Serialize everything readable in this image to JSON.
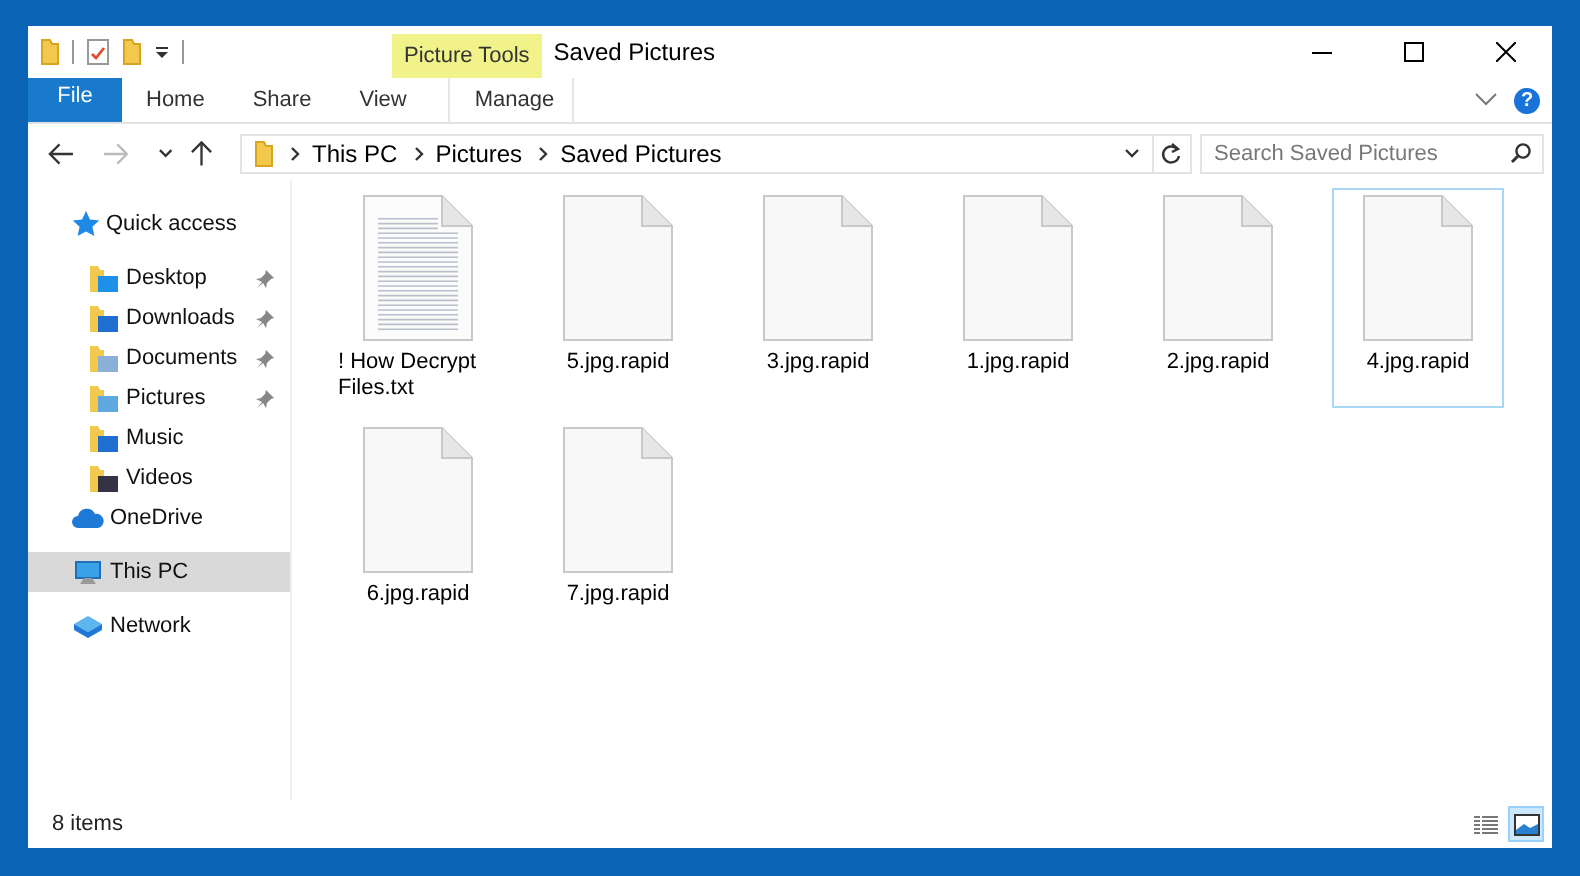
{
  "title_bar": {
    "title": "Saved Pictures",
    "context_label": "Picture Tools"
  },
  "ribbon": {
    "tabs": [
      {
        "label": "File",
        "kind": "file"
      },
      {
        "label": "Home",
        "kind": "tab"
      },
      {
        "label": "Share",
        "kind": "tab"
      },
      {
        "label": "View",
        "kind": "tab"
      },
      {
        "label": "Manage",
        "kind": "context"
      }
    ],
    "help": "?"
  },
  "nav_buttons": [
    {
      "kind": "back",
      "disabled": false
    },
    {
      "kind": "forward",
      "disabled": true
    },
    {
      "kind": "recent",
      "disabled": false
    },
    {
      "kind": "up",
      "disabled": false
    }
  ],
  "address": {
    "crumbs": [
      "This PC",
      "Pictures",
      "Saved Pictures"
    ]
  },
  "search": {
    "placeholder": "Search Saved Pictures"
  },
  "sidebar": {
    "items": [
      {
        "label": "Quick access",
        "kind": "star",
        "selected": false,
        "children": [
          {
            "label": "Desktop",
            "kind": "desktop",
            "pinned": true,
            "selected": false
          },
          {
            "label": "Downloads",
            "kind": "downloads",
            "pinned": true,
            "selected": false
          },
          {
            "label": "Documents",
            "kind": "documents",
            "pinned": true,
            "selected": false
          },
          {
            "label": "Pictures",
            "kind": "pictures",
            "pinned": true,
            "selected": false
          },
          {
            "label": "Music",
            "kind": "music",
            "pinned": false,
            "selected": false
          },
          {
            "label": "Videos",
            "kind": "videos",
            "pinned": false,
            "selected": false
          }
        ]
      },
      {
        "label": "OneDrive",
        "kind": "cloud",
        "selected": false
      },
      {
        "label": "This PC",
        "kind": "pc",
        "selected": true
      },
      {
        "label": "Network",
        "kind": "network",
        "selected": false
      }
    ]
  },
  "files": [
    {
      "name": "! How Decrypt Files.txt",
      "kind": "text",
      "selected": false
    },
    {
      "name": "5.jpg.rapid",
      "kind": "blank",
      "selected": false
    },
    {
      "name": "3.jpg.rapid",
      "kind": "blank",
      "selected": false
    },
    {
      "name": "1.jpg.rapid",
      "kind": "blank",
      "selected": false
    },
    {
      "name": "2.jpg.rapid",
      "kind": "blank",
      "selected": false
    },
    {
      "name": "4.jpg.rapid",
      "kind": "blank",
      "selected": true
    },
    {
      "name": "6.jpg.rapid",
      "kind": "blank",
      "selected": false
    },
    {
      "name": "7.jpg.rapid",
      "kind": "blank",
      "selected": false
    }
  ],
  "status_bar": {
    "count": "8 items",
    "views": [
      {
        "kind": "details",
        "selected": false
      },
      {
        "kind": "large-icons",
        "selected": true
      }
    ]
  }
}
